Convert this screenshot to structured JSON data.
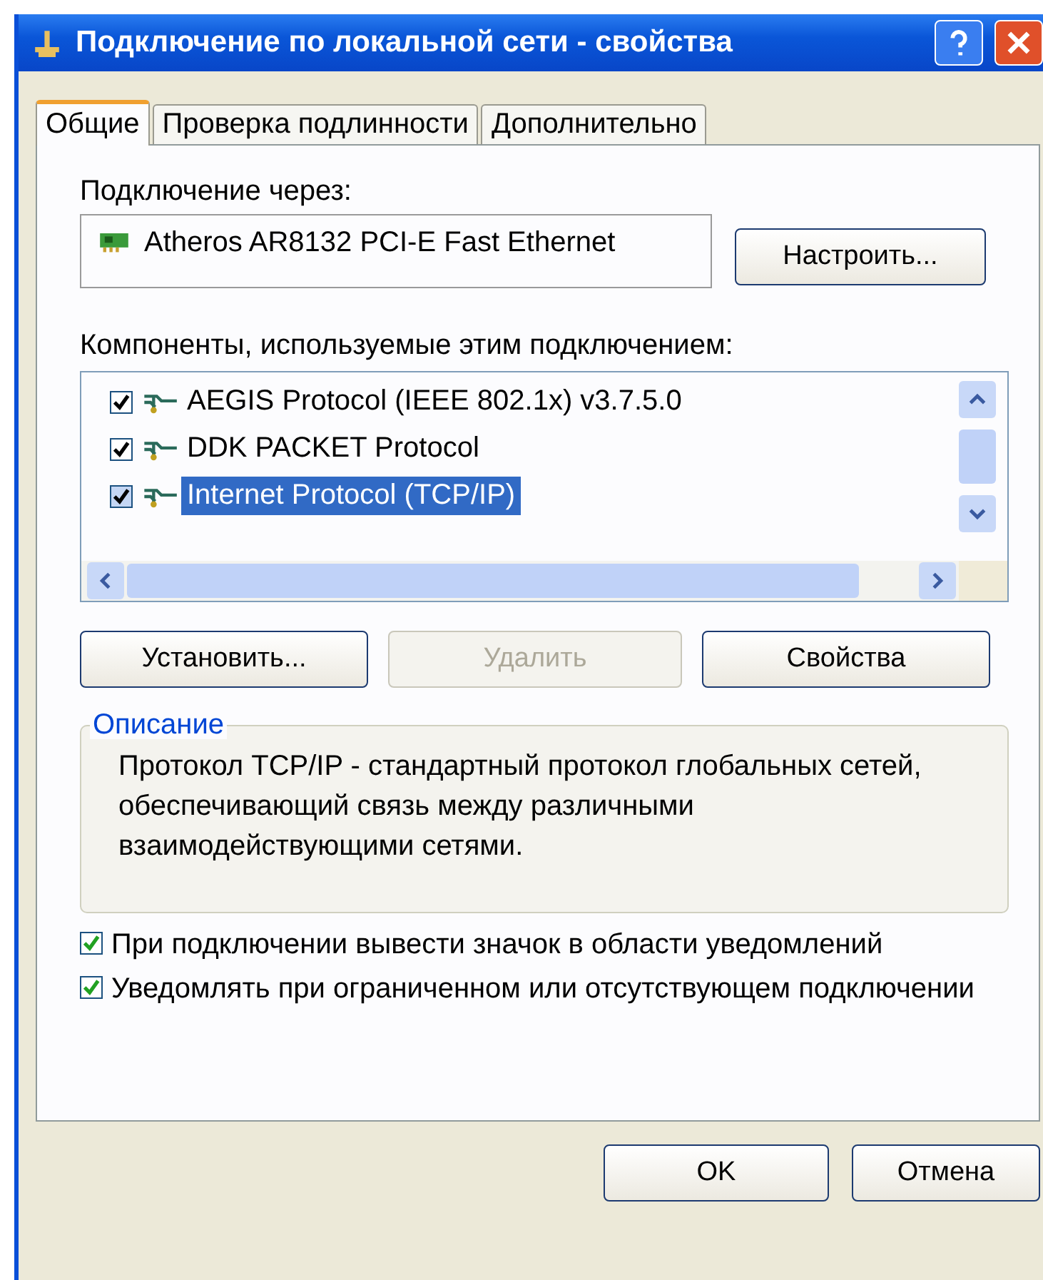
{
  "window": {
    "title": "Подключение по локальной сети - свойства"
  },
  "tabs": [
    {
      "label": "Общие",
      "selected": true
    },
    {
      "label": "Проверка подлинности",
      "selected": false
    },
    {
      "label": "Дополнительно",
      "selected": false
    }
  ],
  "connect_via": {
    "label": "Подключение через:",
    "adapter": "Atheros AR8132 PCI-E Fast Ethernet",
    "configure_button": "Настроить..."
  },
  "components": {
    "label": "Компоненты, используемые этим подключением:",
    "items": [
      {
        "name": "AEGIS Protocol (IEEE 802.1x) v3.7.5.0",
        "checked": true,
        "selected": false
      },
      {
        "name": "DDK PACKET Protocol",
        "checked": true,
        "selected": false
      },
      {
        "name": "Internet Protocol (TCP/IP)",
        "checked": true,
        "selected": true
      }
    ]
  },
  "component_buttons": [
    {
      "label": "Установить...",
      "disabled": false
    },
    {
      "label": "Удалить",
      "disabled": true
    },
    {
      "label": "Свойства",
      "disabled": false
    }
  ],
  "description": {
    "title": "Описание",
    "text": "Протокол TCP/IP - стандартный протокол глобальных сетей, обеспечивающий связь между различными взаимодействующими сетями."
  },
  "options": [
    {
      "label": "При подключении вывести значок в области уведомлений",
      "checked": true
    },
    {
      "label": "Уведомлять при ограниченном или отсутствующем подключении",
      "checked": true
    }
  ],
  "buttons": [
    "OK",
    "Отмена"
  ]
}
